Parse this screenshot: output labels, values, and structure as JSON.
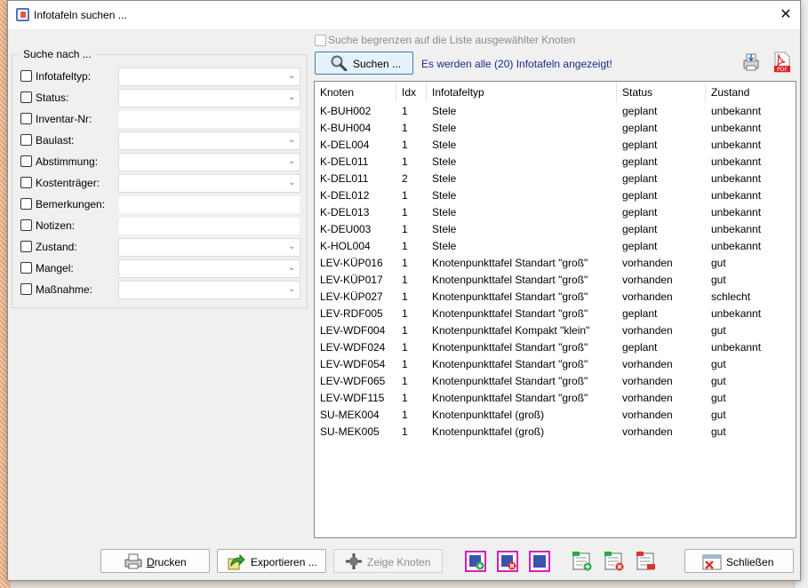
{
  "window": {
    "title": "Infotafeln suchen ..."
  },
  "filter": {
    "legend": "Suche nach ...",
    "fields": [
      {
        "label": "Infotafeltyp:",
        "type": "combo",
        "value": ""
      },
      {
        "label": "Status:",
        "type": "combo",
        "value": ""
      },
      {
        "label": "Inventar-Nr:",
        "type": "text",
        "value": ""
      },
      {
        "label": "Baulast:",
        "type": "combo",
        "value": ""
      },
      {
        "label": "Abstimmung:",
        "type": "combo",
        "value": ""
      },
      {
        "label": "Kostenträger:",
        "type": "combo",
        "value": ""
      },
      {
        "label": "Bemerkungen:",
        "type": "text",
        "value": ""
      },
      {
        "label": "Notizen:",
        "type": "text",
        "value": ""
      },
      {
        "label": "Zustand:",
        "type": "combo",
        "value": ""
      },
      {
        "label": "Mangel:",
        "type": "combo",
        "value": ""
      },
      {
        "label": "Maßnahme:",
        "type": "combo",
        "value": ""
      }
    ]
  },
  "restrict_label": "Suche begrenzen auf die Liste ausgewählter Knoten",
  "search_button": "Suchen ...",
  "result_info": "Es werden alle (20) Infotafeln angezeigt!",
  "table": {
    "columns": [
      "Knoten",
      "Idx",
      "Infotafeltyp",
      "Status",
      "Zustand"
    ],
    "rows": [
      [
        "K-BUH002",
        "1",
        "Stele",
        "geplant",
        "unbekannt"
      ],
      [
        "K-BUH004",
        "1",
        "Stele",
        "geplant",
        "unbekannt"
      ],
      [
        "K-DEL004",
        "1",
        "Stele",
        "geplant",
        "unbekannt"
      ],
      [
        "K-DEL011",
        "1",
        "Stele",
        "geplant",
        "unbekannt"
      ],
      [
        "K-DEL011",
        "2",
        "Stele",
        "geplant",
        "unbekannt"
      ],
      [
        "K-DEL012",
        "1",
        "Stele",
        "geplant",
        "unbekannt"
      ],
      [
        "K-DEL013",
        "1",
        "Stele",
        "geplant",
        "unbekannt"
      ],
      [
        "K-DEU003",
        "1",
        "Stele",
        "geplant",
        "unbekannt"
      ],
      [
        "K-HOL004",
        "1",
        "Stele",
        "geplant",
        "unbekannt"
      ],
      [
        "LEV-KÜP016",
        "1",
        "Knotenpunkttafel Standart \"groß\"",
        "vorhanden",
        "gut"
      ],
      [
        "LEV-KÜP017",
        "1",
        "Knotenpunkttafel Standart \"groß\"",
        "vorhanden",
        "gut"
      ],
      [
        "LEV-KÜP027",
        "1",
        "Knotenpunkttafel Standart \"groß\"",
        "vorhanden",
        "schlecht"
      ],
      [
        "LEV-RDF005",
        "1",
        "Knotenpunkttafel Standart \"groß\"",
        "geplant",
        "unbekannt"
      ],
      [
        "LEV-WDF004",
        "1",
        "Knotenpunkttafel Kompakt \"klein\"",
        "vorhanden",
        "gut"
      ],
      [
        "LEV-WDF024",
        "1",
        "Knotenpunkttafel Standart \"groß\"",
        "geplant",
        "unbekannt"
      ],
      [
        "LEV-WDF054",
        "1",
        "Knotenpunkttafel Standart \"groß\"",
        "vorhanden",
        "gut"
      ],
      [
        "LEV-WDF065",
        "1",
        "Knotenpunkttafel Standart \"groß\"",
        "vorhanden",
        "gut"
      ],
      [
        "LEV-WDF115",
        "1",
        "Knotenpunkttafel Standart \"groß\"",
        "vorhanden",
        "gut"
      ],
      [
        "SU-MEK004",
        "1",
        "Knotenpunkttafel (groß)",
        "vorhanden",
        "gut"
      ],
      [
        "SU-MEK005",
        "1",
        "Knotenpunkttafel (groß)",
        "vorhanden",
        "gut"
      ]
    ]
  },
  "buttons": {
    "print": {
      "mnemonic": "D",
      "rest": "rucken"
    },
    "export": "Exportieren ...",
    "show_nodes": "Zeige Knoten",
    "close": "Schließen"
  },
  "icons": {
    "app": "infotafel-app-icon",
    "search": "magnifier-icon",
    "print": "printer-icon",
    "pdf": "pdf-icon"
  },
  "colors": {
    "accent_border": "#3c7fb1",
    "info_text": "#1c2a8c",
    "magenta_frame": "#d81fb9"
  }
}
